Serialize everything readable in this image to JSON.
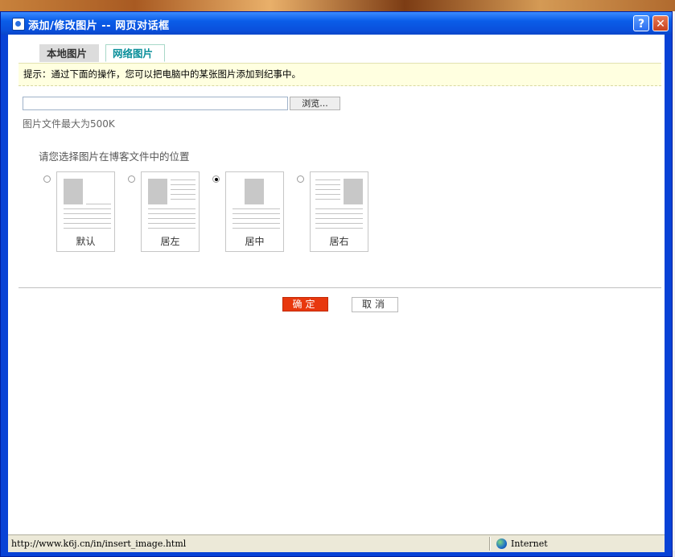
{
  "dialog": {
    "title": "添加/修改图片 -- 网页对话框",
    "help_label": "?",
    "close_label": "✕"
  },
  "tabs": [
    {
      "label": "本地图片",
      "active": false
    },
    {
      "label": "网络图片",
      "active": true
    }
  ],
  "tip": "提示：通过下面的操作，您可以把电脑中的某张图片添加到纪事中。",
  "file": {
    "value": "",
    "browse_label": "浏览...",
    "size_hint": "图片文件最大为500K"
  },
  "position": {
    "label": "请您选择图片在博客文件中的位置",
    "options": [
      {
        "caption": "默认",
        "selected": false
      },
      {
        "caption": "居左",
        "selected": false
      },
      {
        "caption": "居中",
        "selected": true
      },
      {
        "caption": "居右",
        "selected": false
      }
    ]
  },
  "buttons": {
    "ok": "确定",
    "cancel": "取消"
  },
  "status": {
    "url": "http://www.k6j.cn/in/insert_image.html",
    "zone": "Internet"
  },
  "colors": {
    "title_bar": "#0a5de8",
    "ok_button": "#e8380e",
    "tip_background": "#ffffe0",
    "active_tab_text": "#0a8f9a"
  }
}
